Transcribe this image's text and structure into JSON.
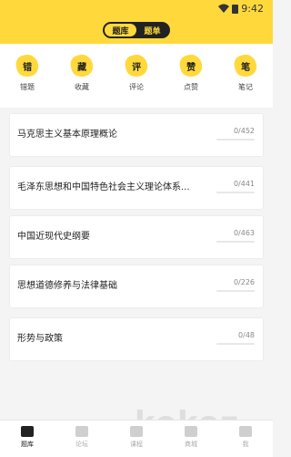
{
  "status": {
    "time": "9:42"
  },
  "segment": {
    "active": "题库",
    "inactive": "题单"
  },
  "quick_actions": [
    {
      "badge": "错",
      "label": "错题"
    },
    {
      "badge": "藏",
      "label": "收藏"
    },
    {
      "badge": "评",
      "label": "评论"
    },
    {
      "badge": "赞",
      "label": "点赞"
    },
    {
      "badge": "笔",
      "label": "笔记"
    }
  ],
  "subjects": [
    {
      "title": "马克思主义基本原理概论",
      "count": "0/452"
    },
    {
      "title": "毛泽东思想和中国特色社会主义理论体系...",
      "count": "0/441"
    },
    {
      "title": "中国近现代史纲要",
      "count": "0/463"
    },
    {
      "title": "思想道德修养与法律基础",
      "count": "0/226"
    },
    {
      "title": "形势与政策",
      "count": "0/48"
    }
  ],
  "tabs": [
    {
      "label": "题库",
      "active": true
    },
    {
      "label": "论坛",
      "active": false
    },
    {
      "label": "课程",
      "active": false
    },
    {
      "label": "商城",
      "active": false
    },
    {
      "label": "我",
      "active": false
    }
  ],
  "watermark": "kokoz",
  "colors": {
    "accent": "#ffd93b",
    "dark": "#222222"
  }
}
